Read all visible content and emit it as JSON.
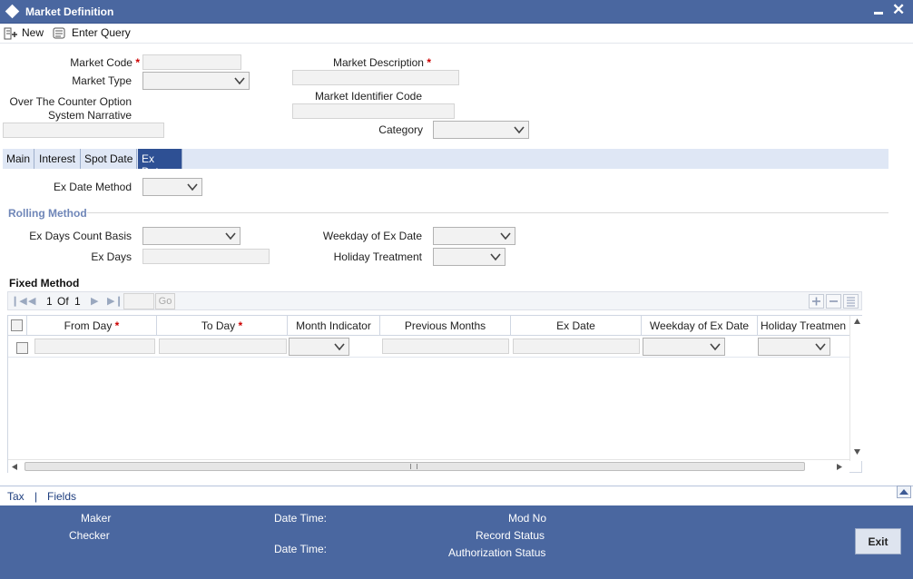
{
  "window": {
    "title": "Market Definition",
    "minimize_icon": "minimize-icon",
    "close_icon": "close-icon",
    "close_glyph": "✕"
  },
  "toolbar": {
    "new_label": "New",
    "enter_query_label": "Enter Query"
  },
  "header": {
    "market_code_label": "Market Code",
    "market_type_label": "Market Type",
    "otc_label_line1": "Over The Counter Option",
    "otc_label_line2": "System Narrative",
    "market_description_label": "Market Description",
    "market_identifier_code_label": "Market Identifier Code",
    "category_label": "Category",
    "required_mark": "*"
  },
  "tabs": [
    {
      "label": "Main"
    },
    {
      "label": "Interest"
    },
    {
      "label": "Spot Date"
    },
    {
      "label": "Ex Date"
    }
  ],
  "ex_date": {
    "ex_date_method_label": "Ex Date Method",
    "rolling_method_title": "Rolling Method",
    "ex_days_count_basis_label": "Ex Days Count Basis",
    "ex_days_label": "Ex Days",
    "weekday_of_ex_date_label": "Weekday of Ex Date",
    "holiday_treatment_label": "Holiday Treatment",
    "fixed_method_title": "Fixed Method"
  },
  "grid": {
    "page_current": "1",
    "page_of": "Of",
    "page_total": "1",
    "go_label": "Go",
    "columns": [
      "From Day",
      "To Day",
      "Month Indicator",
      "Previous Months",
      "Ex Date",
      "Weekday of Ex Date",
      "Holiday Treatmen"
    ]
  },
  "footer_links": {
    "tax_label": "Tax",
    "separator": "|",
    "fields_label": "Fields"
  },
  "audit": {
    "maker_label": "Maker",
    "checker_label": "Checker",
    "date_time_label_1": "Date Time:",
    "date_time_label_2": "Date Time:",
    "mod_no_label": "Mod No",
    "record_status_label": "Record Status",
    "authorization_status_label": "Authorization Status",
    "exit_label": "Exit"
  }
}
